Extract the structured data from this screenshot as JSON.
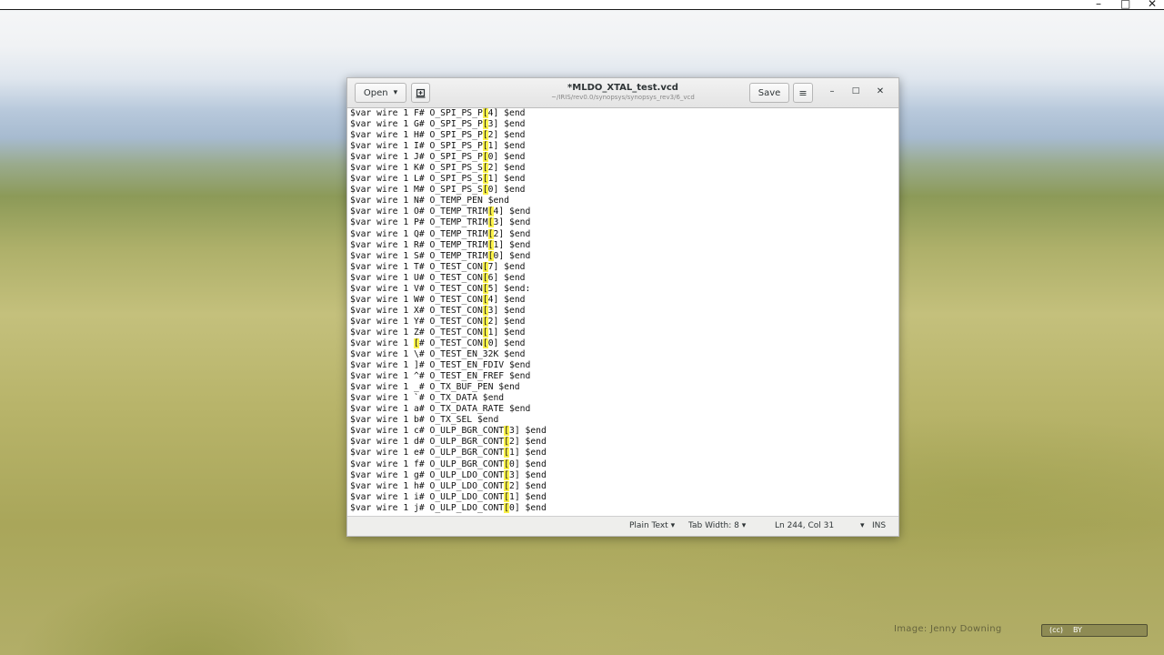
{
  "desktop": {
    "top_controls": {
      "minimize": "–",
      "maximize": "□",
      "close": "✕"
    },
    "credit_text": "Image: Jenny Downing",
    "cc_badge": {
      "label_cc": "(cc)",
      "label_by": "BY"
    }
  },
  "window": {
    "title": "*MLDO_XTAL_test.vcd",
    "subtitle": "~/IRIS/rev0.0/synopsys/synopsys_rev3/6_vcd",
    "open_label": "Open",
    "open_chevron": "▾",
    "save_label": "Save",
    "menu_icon": "≡",
    "minimize_icon": "–",
    "maximize_icon": "□",
    "close_icon": "✕"
  },
  "editor": {
    "lines": [
      {
        "pre": "$var wire 1 F# O_SPI_PS_P",
        "hl": "[",
        "post": "4] $end"
      },
      {
        "pre": "$var wire 1 G# O_SPI_PS_P",
        "hl": "[",
        "post": "3] $end"
      },
      {
        "pre": "$var wire 1 H# O_SPI_PS_P",
        "hl": "[",
        "post": "2] $end"
      },
      {
        "pre": "$var wire 1 I# O_SPI_PS_P",
        "hl": "[",
        "post": "1] $end"
      },
      {
        "pre": "$var wire 1 J# O_SPI_PS_P",
        "hl": "[",
        "post": "0] $end"
      },
      {
        "pre": "$var wire 1 K# O_SPI_PS_S",
        "hl": "[",
        "post": "2] $end"
      },
      {
        "pre": "$var wire 1 L# O_SPI_PS_S",
        "hl": "[",
        "post": "1] $end"
      },
      {
        "pre": "$var wire 1 M# O_SPI_PS_S",
        "hl": "[",
        "post": "0] $end"
      },
      {
        "pre": "$var wire 1 N# O_TEMP_PEN $end",
        "hl": "",
        "post": ""
      },
      {
        "pre": "$var wire 1 O# O_TEMP_TRIM",
        "hl": "[",
        "post": "4] $end"
      },
      {
        "pre": "$var wire 1 P# O_TEMP_TRIM",
        "hl": "[",
        "post": "3] $end"
      },
      {
        "pre": "$var wire 1 Q# O_TEMP_TRIM",
        "hl": "[",
        "post": "2] $end"
      },
      {
        "pre": "$var wire 1 R# O_TEMP_TRIM",
        "hl": "[",
        "post": "1] $end"
      },
      {
        "pre": "$var wire 1 S# O_TEMP_TRIM",
        "hl": "[",
        "post": "0] $end"
      },
      {
        "pre": "$var wire 1 T# O_TEST_CON",
        "hl": "[",
        "post": "7] $end"
      },
      {
        "pre": "$var wire 1 U# O_TEST_CON",
        "hl": "[",
        "post": "6] $end"
      },
      {
        "pre": "$var wire 1 V# O_TEST_CON",
        "hl": "[",
        "post": "5] $end:"
      },
      {
        "pre": "$var wire 1 W# O_TEST_CON",
        "hl": "[",
        "post": "4] $end"
      },
      {
        "pre": "$var wire 1 X# O_TEST_CON",
        "hl": "[",
        "post": "3] $end"
      },
      {
        "pre": "$var wire 1 Y# O_TEST_CON",
        "hl": "[",
        "post": "2] $end"
      },
      {
        "pre": "$var wire 1 Z# O_TEST_CON",
        "hl": "[",
        "post": "1] $end"
      },
      {
        "pre": "$var wire 1 ",
        "hl": "[",
        "post": "# O_TEST_CON[0] $end",
        "hl2_pre": "$var wire 1 [# O_TEST_CON",
        "hl2": "[",
        "hl2_post": "0] $end"
      },
      {
        "pre": "$var wire 1 \\# O_TEST_EN_32K $end",
        "hl": "",
        "post": ""
      },
      {
        "pre": "$var wire 1 ]# O_TEST_EN_FDIV $end",
        "hl": "",
        "post": ""
      },
      {
        "pre": "$var wire 1 ^# O_TEST_EN_FREF $end",
        "hl": "",
        "post": ""
      },
      {
        "pre": "$var wire 1 _# O_TX_BUF_PEN $end",
        "hl": "",
        "post": ""
      },
      {
        "pre": "$var wire 1 `# O_TX_DATA $end",
        "hl": "",
        "post": ""
      },
      {
        "pre": "$var wire 1 a# O_TX_DATA_RATE $end",
        "hl": "",
        "post": ""
      },
      {
        "pre": "$var wire 1 b# O_TX_SEL $end",
        "hl": "",
        "post": ""
      },
      {
        "pre": "$var wire 1 c# O_ULP_BGR_CONT",
        "hl": "[",
        "post": "3] $end"
      },
      {
        "pre": "$var wire 1 d# O_ULP_BGR_CONT",
        "hl": "[",
        "post": "2] $end"
      },
      {
        "pre": "$var wire 1 e# O_ULP_BGR_CONT",
        "hl": "[",
        "post": "1] $end"
      },
      {
        "pre": "$var wire 1 f# O_ULP_BGR_CONT",
        "hl": "[",
        "post": "0] $end"
      },
      {
        "pre": "$var wire 1 g# O_ULP_LDO_CONT",
        "hl": "[",
        "post": "3] $end"
      },
      {
        "pre": "$var wire 1 h# O_ULP_LDO_CONT",
        "hl": "[",
        "post": "2] $end"
      },
      {
        "pre": "$var wire 1 i# O_ULP_LDO_CONT",
        "hl": "[",
        "post": "1] $end"
      },
      {
        "pre": "$var wire 1 j# O_ULP_LDO_CONT",
        "hl": "[",
        "post": "0] $end"
      }
    ]
  },
  "statusbar": {
    "language": "Plain Text",
    "tab_width": "Tab Width: 8",
    "position": "Ln 244, Col 31",
    "mode": "INS",
    "dropdown_icon": "▾"
  }
}
